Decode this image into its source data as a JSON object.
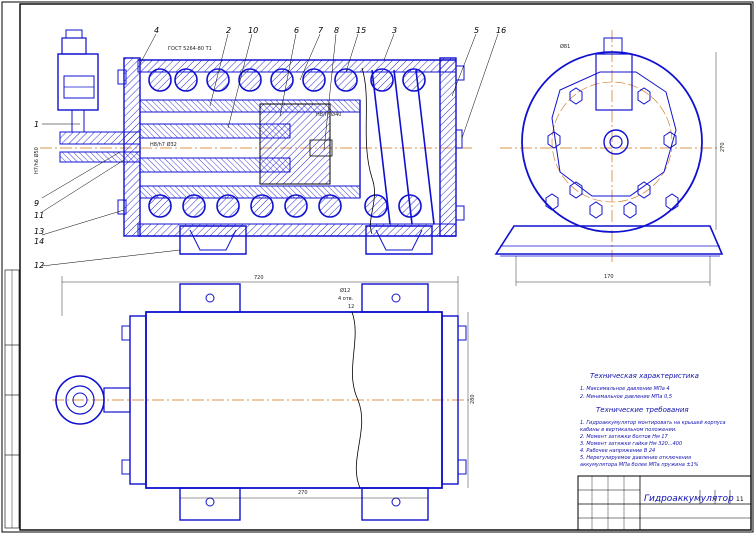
{
  "drawing": {
    "title": "Гидроаккумулятор",
    "title_block_sheet": "11",
    "callouts": [
      "1",
      "2",
      "3",
      "4",
      "5",
      "6",
      "7",
      "8",
      "9",
      "10",
      "11",
      "12",
      "13",
      "14",
      "15",
      "16"
    ],
    "dimensions": {
      "overall_length": "720",
      "height_plan": "280",
      "bolt_span": "270",
      "flange_height": "270",
      "bolt_hole": "Ø12",
      "bolt_holes_count": "4 отв.",
      "bolt_offset": "12",
      "base_width": "170",
      "side_dia": "Ø81",
      "fit_1": "Н8/h7 Ø32",
      "fit_2": "Н8/f7 Ø40",
      "fit_3": "Н7/h6 Ø50",
      "gost": "ГОСТ 5264-80 Т1"
    },
    "tech_characteristics": {
      "heading": "Техническая характеристика",
      "lines": [
        "1. Максимальное давление  МПа       4",
        "2. Минимальное давление   МПа      0,5"
      ]
    },
    "tech_requirements": {
      "heading": "Технические требования",
      "lines": [
        "1. Гидроаккумулятор монтировать на крышей корпуса",
        "    кабины в вертикальном положении.",
        "2. Момент затяжки болтов  Нм      17",
        "3. Момент затяжки гайки  Нм    320...400",
        "4. Рабочее напряжение  В        24",
        "5. Нерегулируемое давление отключения",
        "    аккумулятора  МПа  более  МПа  пружина  ±1%"
      ]
    },
    "colors": {
      "outline": "#000000",
      "detail": "#1010d0",
      "axis": "#d07010",
      "section": "#1010d0"
    }
  }
}
